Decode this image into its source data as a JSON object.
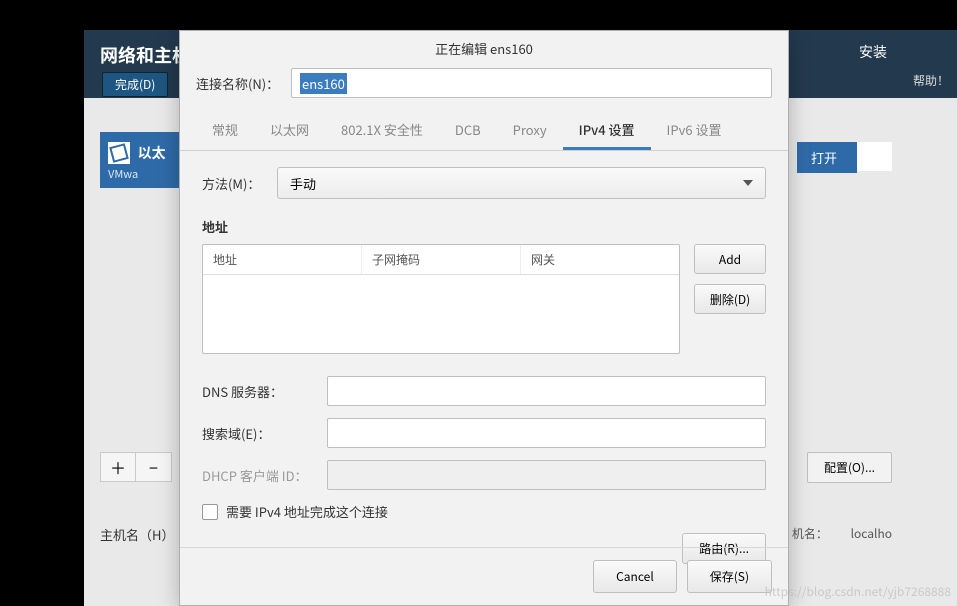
{
  "header": {
    "title": "网络和主机",
    "done_btn": "完成(D)",
    "install_marker": "安装",
    "help_btn": "帮助！"
  },
  "sidebar": {
    "nic_prefix": "以太",
    "nic_sub": "VMwa"
  },
  "right_panel": {
    "open_btn": "打开",
    "config_btn": "配置(O)...",
    "plus": "＋",
    "minus": "−"
  },
  "hostname_row": {
    "label": "主机名（H）",
    "label2": "机名：",
    "value": "localho"
  },
  "dialog": {
    "title": "正在编辑 ens160",
    "conn_name_label": "连接名称(N)：",
    "conn_name_value": "ens160",
    "tabs": [
      "常规",
      "以太网",
      "802.1X 安全性",
      "DCB",
      "Proxy",
      "IPv4 设置",
      "IPv6 设置"
    ],
    "active_tab": 5,
    "method_label": "方法(M)：",
    "method_value": "手动",
    "addr_section": "地址",
    "addr_headers": [
      "地址",
      "子网掩码",
      "网关"
    ],
    "add_btn": "Add",
    "delete_btn": "删除(D)",
    "dns_label": "DNS 服务器：",
    "search_label": "搜索域(E)：",
    "dhcp_label": "DHCP 客户端 ID：",
    "require_ipv4": "需要 IPv4 地址完成这个连接",
    "routes_btn": "路由(R)...",
    "cancel_btn": "Cancel",
    "save_btn": "保存(S)"
  },
  "watermark": "https://blog.csdn.net/yjb7268888"
}
